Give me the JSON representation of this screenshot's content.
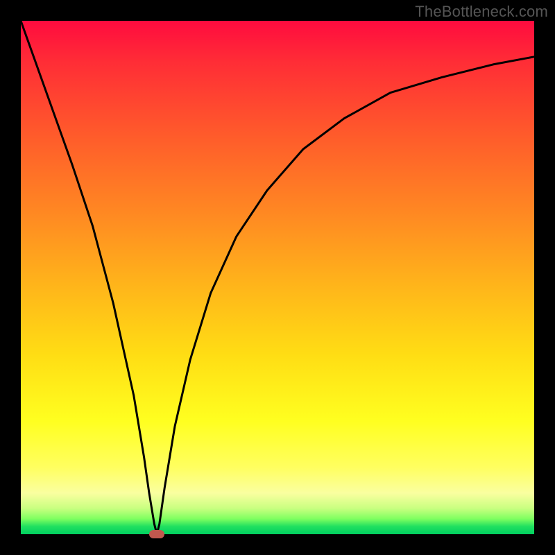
{
  "attribution": "TheBottleneck.com",
  "chart_data": {
    "type": "line",
    "title": "",
    "xlabel": "",
    "ylabel": "",
    "xlim": [
      0,
      100
    ],
    "ylim": [
      0,
      100
    ],
    "curve": [
      {
        "x": 0,
        "y": 100
      },
      {
        "x": 5,
        "y": 86
      },
      {
        "x": 10,
        "y": 72
      },
      {
        "x": 14,
        "y": 60
      },
      {
        "x": 18,
        "y": 45
      },
      {
        "x": 22,
        "y": 27
      },
      {
        "x": 24,
        "y": 15
      },
      {
        "x": 25,
        "y": 8
      },
      {
        "x": 26,
        "y": 2
      },
      {
        "x": 26.5,
        "y": 0
      },
      {
        "x": 27,
        "y": 2
      },
      {
        "x": 28,
        "y": 9
      },
      {
        "x": 30,
        "y": 21
      },
      {
        "x": 33,
        "y": 34
      },
      {
        "x": 37,
        "y": 47
      },
      {
        "x": 42,
        "y": 58
      },
      {
        "x": 48,
        "y": 67
      },
      {
        "x": 55,
        "y": 75
      },
      {
        "x": 63,
        "y": 81
      },
      {
        "x": 72,
        "y": 86
      },
      {
        "x": 82,
        "y": 89
      },
      {
        "x": 92,
        "y": 91.5
      },
      {
        "x": 100,
        "y": 93
      }
    ],
    "marker": {
      "x": 26.5,
      "y": 0,
      "color": "#c0584e"
    },
    "background_gradient": {
      "top": "#ff0b3f",
      "mid_upper": "#ff8a22",
      "mid": "#ffdd14",
      "lower": "#ffff60",
      "bottom": "#00d060"
    }
  }
}
